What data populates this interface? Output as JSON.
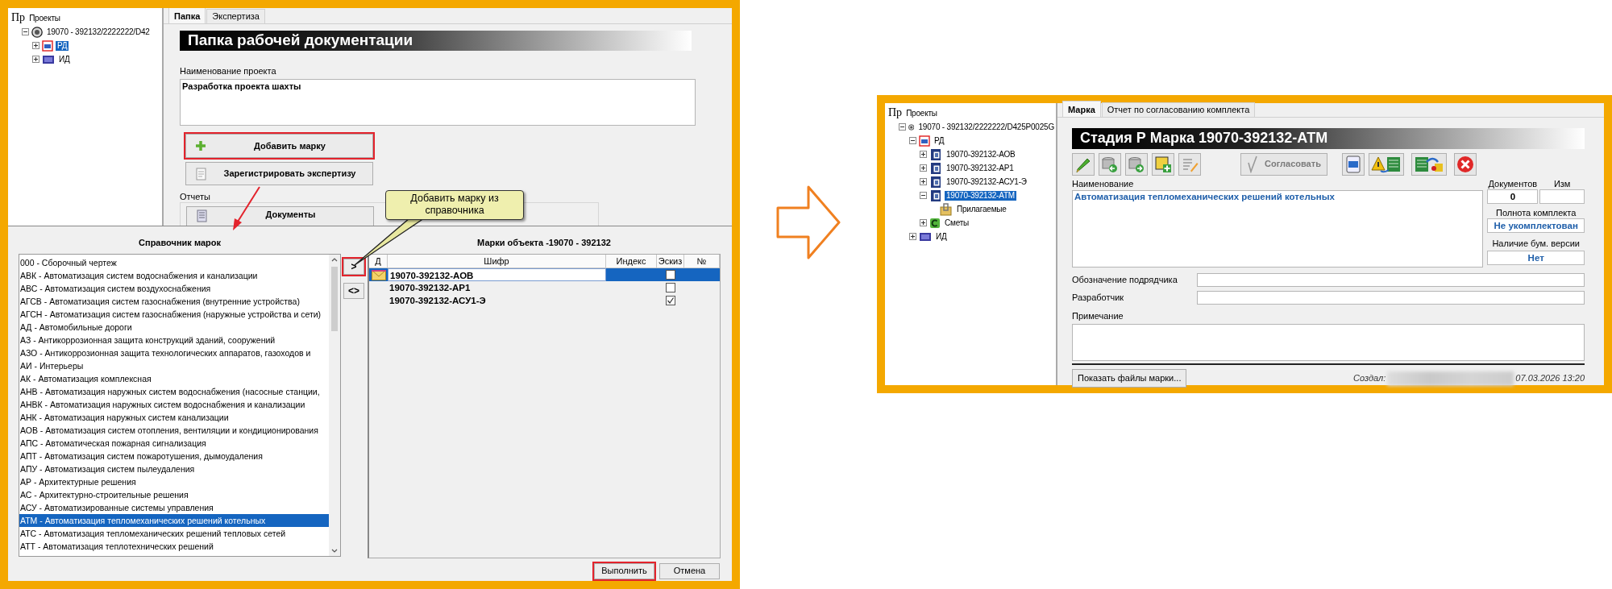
{
  "left_window": {
    "tree": [
      {
        "prefix": "Пр",
        "label": "Проекты",
        "selected": false,
        "children": [
          {
            "kind": "project",
            "label": "19070 - 392132/2222222/D42",
            "expanded": true,
            "selected": false,
            "children": [
              {
                "kind": "rd",
                "label": "РД",
                "expanded": false,
                "selected": true
              },
              {
                "kind": "id",
                "label": "ИД",
                "expanded": false,
                "selected": false
              }
            ]
          }
        ]
      }
    ],
    "tabs": [
      {
        "label": "Папка",
        "selected": true
      },
      {
        "label": "Экспертиза",
        "selected": false
      }
    ],
    "title": "Папка рабочей документации",
    "project_name": {
      "label": "Наименование проекта",
      "value": "Разработка проекта шахты"
    },
    "buttons": [
      {
        "kind": "add",
        "label": "Добавить марку",
        "highlighted": true
      },
      {
        "kind": "register",
        "label": "Зарегистрировать экспертизу",
        "highlighted": false
      }
    ],
    "reports": {
      "label": "Отчеты",
      "buttons": [
        {
          "kind": "documents",
          "label": "Документы",
          "highlighted": false
        }
      ]
    },
    "callout": "Добавить марку из справочника"
  },
  "dialog": {
    "catalog": {
      "title": "Справочник марок",
      "items": [
        {
          "label": "000 - Сборочный чертеж",
          "selected": false
        },
        {
          "label": "АВК - Автоматизация систем водоснабжения и канализации",
          "selected": false
        },
        {
          "label": "АВС - Автоматизация систем воздухоснабжения",
          "selected": false
        },
        {
          "label": "АГСВ - Автоматизация систем газоснабжения (внутренние устройства)",
          "selected": false
        },
        {
          "label": "АГСН - Автоматизация систем газоснабжения (наружные устройства и сети)",
          "selected": false
        },
        {
          "label": "АД - Автомобильные дороги",
          "selected": false
        },
        {
          "label": "АЗ - Антикоррозионная защита конструкций зданий, сооружений",
          "selected": false
        },
        {
          "label": "АЗО - Антикоррозионная защита технологических аппаратов, газоходов и",
          "selected": false
        },
        {
          "label": "АИ - Интерьеры",
          "selected": false
        },
        {
          "label": "АК - Автоматизация комплексная",
          "selected": false
        },
        {
          "label": "АНВ - Автоматизация наружных систем водоснабжения (насосные станции,",
          "selected": false
        },
        {
          "label": "АНВК - Автоматизация наружных систем водоснабжения и канализации",
          "selected": false
        },
        {
          "label": "АНК - Автоматизация наружных систем канализации",
          "selected": false
        },
        {
          "label": "АОВ - Автоматизация систем отопления, вентиляции и кондиционирования",
          "selected": false
        },
        {
          "label": "АПС - Автоматическая пожарная сигнализация",
          "selected": false
        },
        {
          "label": "АПТ - Автоматизация систем пожаротушения, дымоудаления",
          "selected": false
        },
        {
          "label": "АПУ - Автоматизация систем пылеудаления",
          "selected": false
        },
        {
          "label": "АР - Архитектурные решения",
          "selected": false
        },
        {
          "label": "АС - Архитектурно-строительные решения",
          "selected": false
        },
        {
          "label": "АСУ - Автоматизированные системы управления",
          "selected": false
        },
        {
          "label": "АТМ - Автоматизация тепломеханических решений котельных",
          "selected": true
        },
        {
          "label": "АТС - Автоматизация тепломеханических решений тепловых сетей",
          "selected": false
        },
        {
          "label": "АТТ - Автоматизация теплотехнических решений",
          "selected": false
        }
      ]
    },
    "move_buttons": [
      {
        "label": ">",
        "highlighted": true
      },
      {
        "label": "<>",
        "highlighted": false
      }
    ],
    "marks": {
      "title": "Марки объекта -19070 - 392132",
      "columns": [
        "Д",
        "Шифр",
        "Индекс",
        "Эскиз",
        "№"
      ],
      "rows": [
        {
          "marker": true,
          "code": "19070-392132-АОВ",
          "sketch": false,
          "selected": true
        },
        {
          "marker": false,
          "code": "19070-392132-АР1",
          "sketch": false,
          "selected": false
        },
        {
          "marker": false,
          "code": "19070-392132-АСУ1-Э",
          "sketch": true,
          "selected": false
        }
      ]
    },
    "footer_buttons": [
      {
        "label": "Выполнить",
        "highlighted": true
      },
      {
        "label": "Отмена",
        "highlighted": false
      }
    ]
  },
  "right_window": {
    "tree": [
      {
        "prefix": "Пр",
        "label": "Проекты",
        "selected": false,
        "children": [
          {
            "kind": "project",
            "label": "19070 - 392132/2222222/D425P0025G",
            "expanded": true,
            "selected": false,
            "children": [
              {
                "kind": "rd",
                "label": "РД",
                "expanded": true,
                "selected": false,
                "children": [
                  {
                    "kind": "mark",
                    "label": "19070-392132-АОВ",
                    "expanded": false,
                    "selected": false
                  },
                  {
                    "kind": "mark",
                    "label": "19070-392132-АР1",
                    "expanded": false,
                    "selected": false
                  },
                  {
                    "kind": "mark",
                    "label": "19070-392132-АСУ1-Э",
                    "expanded": false,
                    "selected": false
                  },
                  {
                    "kind": "mark",
                    "label": "19070-392132-АТМ",
                    "expanded": true,
                    "selected": true,
                    "children": [
                      {
                        "kind": "attach",
                        "label": "Прилагаемые",
                        "selected": false
                      }
                    ]
                  },
                  {
                    "kind": "estimate",
                    "label": "Сметы",
                    "expanded": false,
                    "selected": false
                  }
                ]
              },
              {
                "kind": "id",
                "label": "ИД",
                "expanded": false,
                "selected": false
              }
            ]
          }
        ]
      }
    ],
    "tabs": [
      {
        "label": "Марка",
        "selected": true
      },
      {
        "label": "Отчет по согласованию комплекта",
        "selected": false
      }
    ],
    "title": "Стадия Р Марка 19070-392132-АТМ",
    "toolbar": [
      {
        "kind": "edit"
      },
      {
        "kind": "db-import"
      },
      {
        "kind": "db-export"
      },
      {
        "kind": "note-add"
      },
      {
        "kind": "list-edit"
      },
      {
        "kind": "approve",
        "label": "Согласовать",
        "disabled": true
      },
      {
        "kind": "word"
      },
      {
        "kind": "warn-excel"
      },
      {
        "kind": "excel-export"
      },
      {
        "kind": "delete"
      }
    ],
    "name": {
      "label": "Наименование",
      "value": "Автоматизация тепломеханических решений котельных"
    },
    "documents": {
      "label": "Документов",
      "value": "0"
    },
    "revision": {
      "label": "Изм"
    },
    "completeness": {
      "label": "Полнота комплекта",
      "value": "Не укомплектован"
    },
    "paper_version": {
      "label": "Наличие бум. версии",
      "value": "Нет"
    },
    "fields": [
      {
        "label": "Обозначение подрядчика"
      },
      {
        "label": "Разработчик"
      }
    ],
    "note": {
      "label": "Примечание"
    },
    "show_files_button": "Показать файлы марки...",
    "created": {
      "label": "Создал:",
      "date": "07.03.2026 13:20"
    }
  }
}
